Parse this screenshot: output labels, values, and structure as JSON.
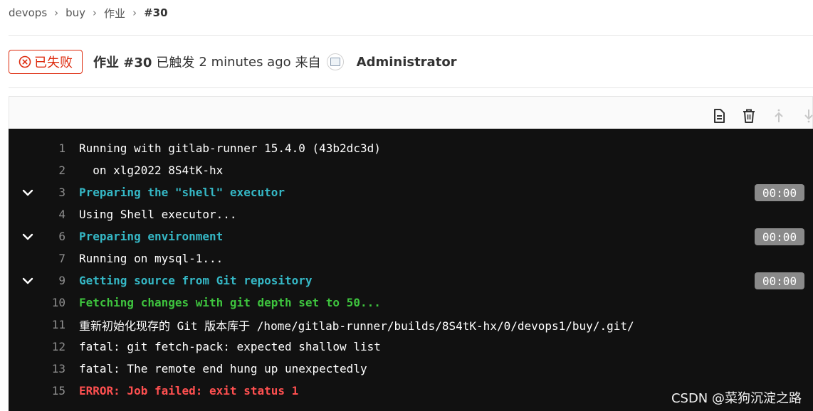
{
  "breadcrumb": {
    "items": [
      "devops",
      "buy",
      "作业",
      "#30"
    ],
    "separator": "›"
  },
  "header": {
    "status_label": "已失败",
    "job_title": "作业 #30",
    "triggered_label": "已触发",
    "time_ago": "2 minutes ago",
    "from_label": "来自",
    "user": "Administrator"
  },
  "toolbar": {
    "icons": [
      "raw-log-icon",
      "erase-log-icon",
      "scroll-top-icon",
      "scroll-bottom-icon"
    ]
  },
  "log": {
    "lines": [
      {
        "num": "1",
        "text": "Running with gitlab-runner 15.4.0 (43b2dc3d)",
        "style": "white"
      },
      {
        "num": "2",
        "text": "  on xlg2022 8S4tK-hx",
        "style": "white"
      },
      {
        "num": "3",
        "text": "Preparing the \"shell\" executor",
        "style": "cyan",
        "collapsible": true,
        "duration": "00:00"
      },
      {
        "num": "4",
        "text": "Using Shell executor...",
        "style": "white"
      },
      {
        "num": "6",
        "text": "Preparing environment",
        "style": "cyan",
        "collapsible": true,
        "duration": "00:00"
      },
      {
        "num": "7",
        "text": "Running on mysql-1...",
        "style": "white"
      },
      {
        "num": "9",
        "text": "Getting source from Git repository",
        "style": "cyan",
        "collapsible": true,
        "duration": "00:00"
      },
      {
        "num": "10",
        "text": "Fetching changes with git depth set to 50...",
        "style": "green"
      },
      {
        "num": "11",
        "text": "重新初始化现存的 Git 版本库于 /home/gitlab-runner/builds/8S4tK-hx/0/devops1/buy/.git/",
        "style": "white"
      },
      {
        "num": "12",
        "text": "fatal: git fetch-pack: expected shallow list",
        "style": "white"
      },
      {
        "num": "13",
        "text": "fatal: The remote end hung up unexpectedly",
        "style": "white"
      },
      {
        "num": "15",
        "text": "ERROR: Job failed: exit status 1",
        "style": "red"
      }
    ]
  },
  "watermark": "CSDN @菜狗沉淀之路",
  "colors": {
    "failed": "#dd2b0e",
    "log_bg": "#111111",
    "section": "#35b8c6",
    "fetch": "#3ec43e",
    "error": "#ff5050"
  }
}
